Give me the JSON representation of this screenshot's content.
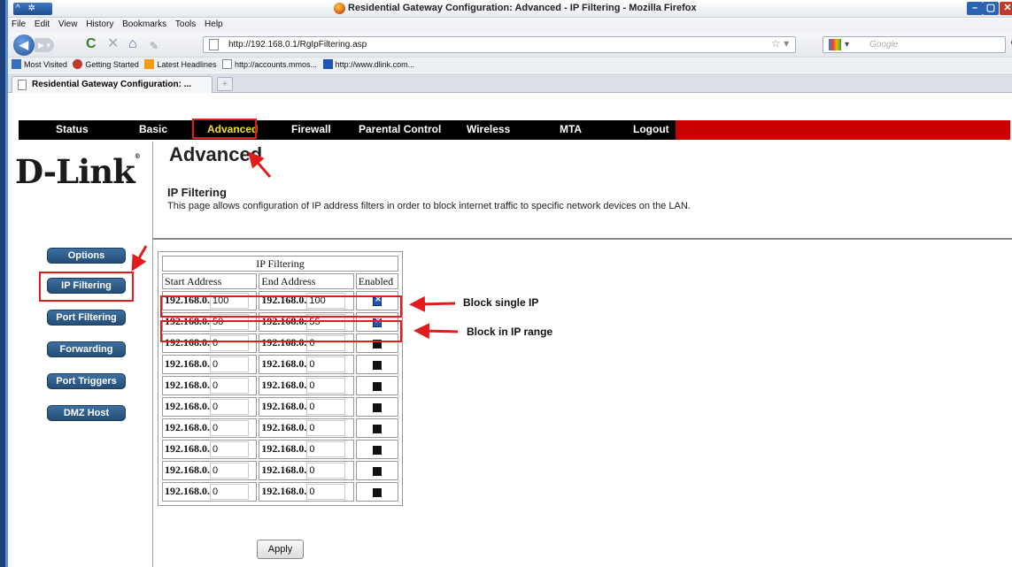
{
  "window": {
    "title": "Residential Gateway Configuration: Advanced - IP Filtering - Mozilla Firefox",
    "controls": {
      "minimize": "–",
      "maximize": "▢",
      "close": "✕"
    }
  },
  "menubar": [
    "File",
    "Edit",
    "View",
    "History",
    "Bookmarks",
    "Tools",
    "Help"
  ],
  "toolbar": {
    "url": "http://192.168.0.1/RgIpFiltering.asp",
    "search_placeholder": "Google"
  },
  "bookmarks": [
    "Most Visited",
    "Getting Started",
    "Latest Headlines",
    "http://accounts.mmos...",
    "http://www.dlink.com..."
  ],
  "tab": {
    "label": "Residential Gateway Configuration: ...",
    "new_tab": "+"
  },
  "nav": {
    "items": [
      "Status",
      "Basic",
      "Advanced",
      "Firewall",
      "Parental Control",
      "Wireless",
      "MTA",
      "Logout"
    ],
    "active": "Advanced"
  },
  "brand": {
    "logo": "D-Link",
    "reg": "®"
  },
  "page": {
    "title": "Advanced",
    "section_title": "IP Filtering",
    "description": "This page allows configuration of IP address filters in order to block internet traffic to specific network devices on the LAN."
  },
  "sidebar": [
    "Options",
    "IP Filtering",
    "Port Filtering",
    "Forwarding",
    "Port Triggers",
    "DMZ Host"
  ],
  "table": {
    "caption": "IP Filtering",
    "headers": [
      "Start Address",
      "End Address",
      "Enabled"
    ],
    "prefix": "192.168.0.",
    "rows": [
      {
        "start": "100",
        "end": "100",
        "enabled": true
      },
      {
        "start": "50",
        "end": "55",
        "enabled": true
      },
      {
        "start": "0",
        "end": "0",
        "enabled": false
      },
      {
        "start": "0",
        "end": "0",
        "enabled": false
      },
      {
        "start": "0",
        "end": "0",
        "enabled": false
      },
      {
        "start": "0",
        "end": "0",
        "enabled": false
      },
      {
        "start": "0",
        "end": "0",
        "enabled": false
      },
      {
        "start": "0",
        "end": "0",
        "enabled": false
      },
      {
        "start": "0",
        "end": "0",
        "enabled": false
      },
      {
        "start": "0",
        "end": "0",
        "enabled": false
      }
    ]
  },
  "buttons": {
    "apply": "Apply"
  },
  "annotations": {
    "single": "Block single IP",
    "range": "Block in IP range"
  },
  "colors": {
    "nav_red": "#cc0000",
    "nav_active": "#f5e01f",
    "annotation_red": "#e21b1b",
    "button_blue": "#2f5f8f"
  }
}
